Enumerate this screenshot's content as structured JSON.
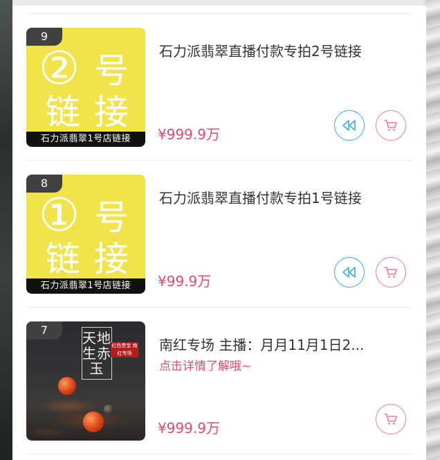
{
  "items": [
    {
      "rank": "9",
      "thumb": {
        "circled_number": "②",
        "char1": "号",
        "char2": "链",
        "char3": "接",
        "banner": "石力派翡翠1号店链接"
      },
      "title": "石力派翡翠直播付款专拍2号链接",
      "price": "¥999.9万",
      "buttons": [
        "replay-icon",
        "cart-icon"
      ]
    },
    {
      "rank": "8",
      "thumb": {
        "circled_number": "①",
        "char1": "号",
        "char2": "链",
        "char3": "接",
        "banner": "石力派翡翠1号店链接"
      },
      "title": "石力派翡翠直播付款专拍1号链接",
      "price": "¥99.9万",
      "buttons": [
        "replay-icon",
        "cart-icon"
      ]
    },
    {
      "rank": "7",
      "thumb": {
        "tile_title": "天地生赤玉",
        "tile_tag": "红色贵宝 南红专场"
      },
      "title": "南红专场 主播：月月11月1日2...",
      "subtitle": "点击详情了解哦~",
      "price": "¥999.9万",
      "buttons": [
        "cart-icon"
      ]
    }
  ],
  "colors": {
    "price": "#e8486c",
    "replay_button": "#34aee4",
    "cart_button": "#f07a95",
    "thumb_yellow": "#f1e34a",
    "rank_badge": "#414141"
  }
}
